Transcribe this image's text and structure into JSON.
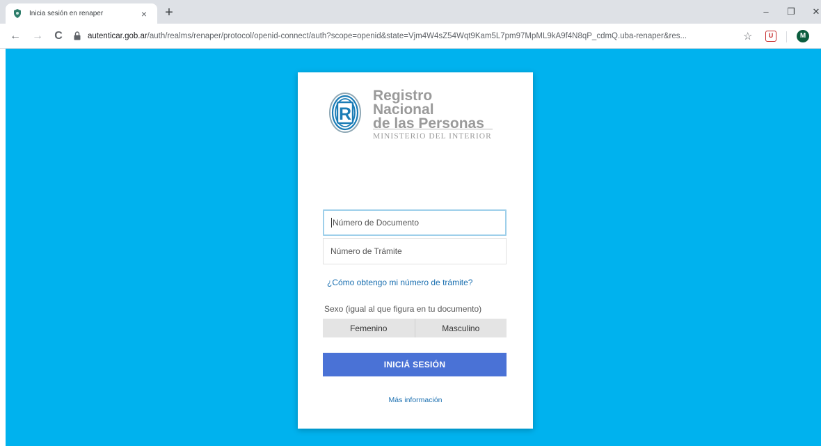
{
  "browser": {
    "tab": {
      "title": "Inicia sesión en renaper",
      "close": "×",
      "favicon": "shield-icon"
    },
    "new_tab": "+",
    "window_controls": {
      "minimize": "–",
      "restore": "❐",
      "close": "✕"
    },
    "nav": {
      "back": "←",
      "forward": "→",
      "reload": "C"
    },
    "url": {
      "host": "autenticar.gob.ar",
      "path": "/auth/realms/renaper/protocol/openid-connect/auth?scope=openid&state=Vjm4W4sZ54Wqt9Kam5L7pm97MpML9kA9f4N8qP_cdmQ.uba-renaper&res..."
    },
    "bookmark": "☆",
    "extension_label": "U",
    "profile_initial": "M"
  },
  "colors": {
    "page_bg": "#00b2ee",
    "button_bg": "#4a72d6",
    "link": "#1a6fb0"
  },
  "logo": {
    "line1": "Registro Nacional",
    "line2": "de las Personas",
    "ministry": "MINISTERIO DEL INTERIOR",
    "mark_letter": "R"
  },
  "form": {
    "documento_placeholder": "Número de Documento",
    "tramite_placeholder": "Número de Trámite",
    "help_link": "¿Cómo obtengo mi número de trámite?",
    "sexo_label": "Sexo (igual al que figura en tu documento)",
    "sexo_options": [
      "Femenino",
      "Masculino"
    ],
    "submit_label": "INICIÁ SESIÓN",
    "more_info": "Más información"
  }
}
